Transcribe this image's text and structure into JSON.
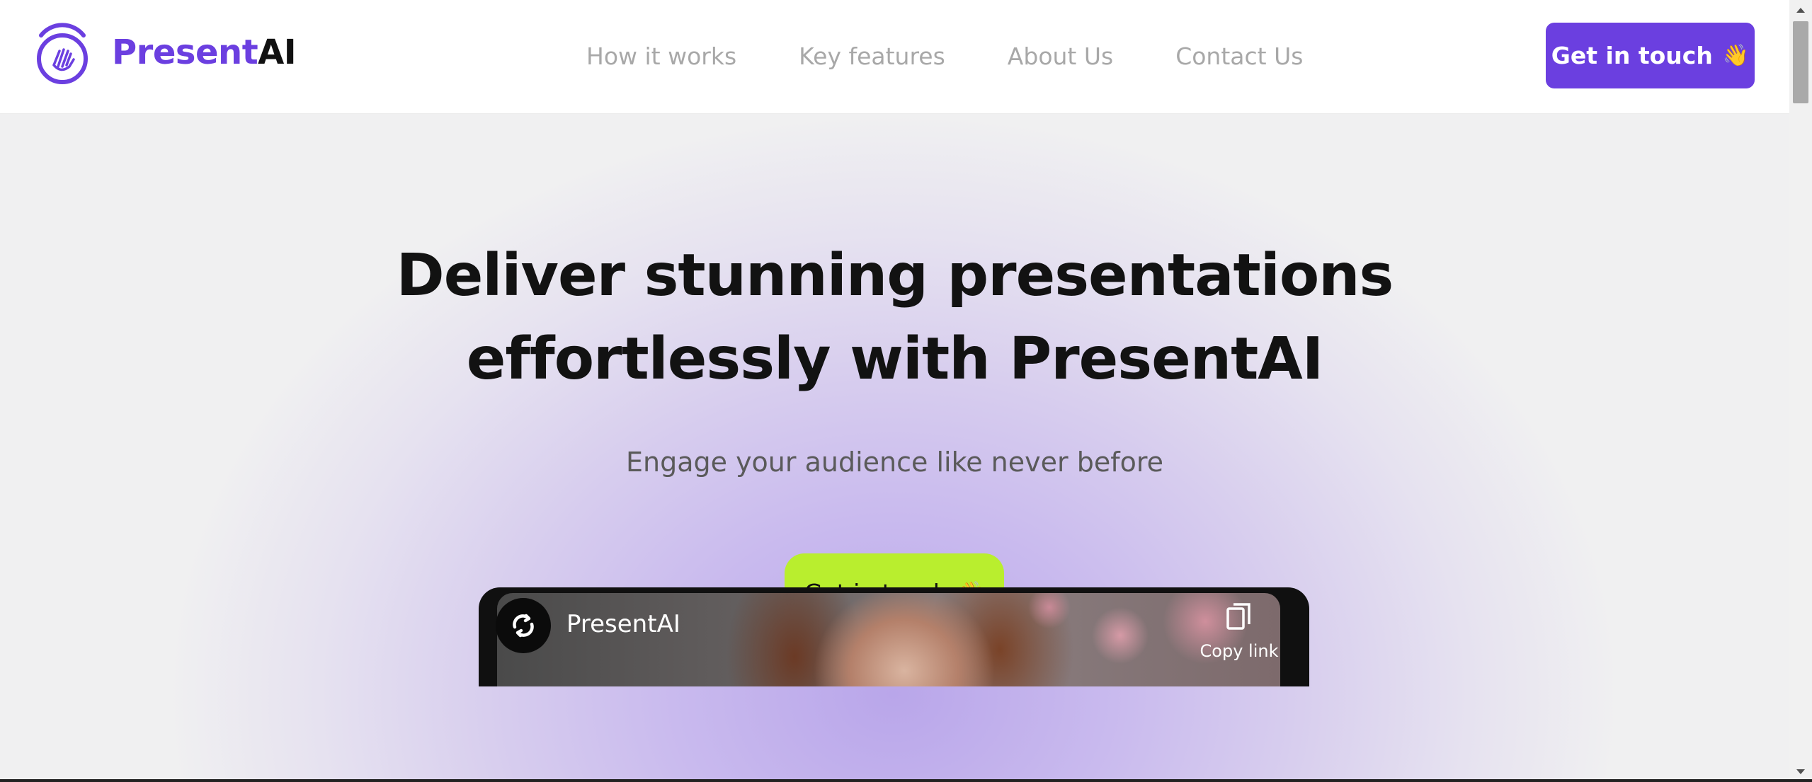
{
  "brand": {
    "name_part1": "Present",
    "name_part2": "AI",
    "primary_color": "#6b3fe0",
    "icon": "waving-hand-logo-icon"
  },
  "nav": {
    "items": [
      {
        "label": "How it works"
      },
      {
        "label": "Key features"
      },
      {
        "label": "About Us"
      },
      {
        "label": "Contact Us"
      }
    ]
  },
  "header_cta": {
    "label": "Get in touch",
    "emoji": "👋",
    "color": "#6b3fe0"
  },
  "hero": {
    "title_line1": "Deliver stunning presentations",
    "title_line2": "effortlessly with PresentAI",
    "subtitle": "Engage your audience like never before",
    "cta_label": "Get in touch",
    "cta_emoji": "👋",
    "cta_color": "#b9ee2e"
  },
  "video": {
    "channel_name": "PresentAI",
    "copy_link_label": "Copy link",
    "icons": [
      "channel-avatar-icon",
      "copy-icon"
    ]
  }
}
